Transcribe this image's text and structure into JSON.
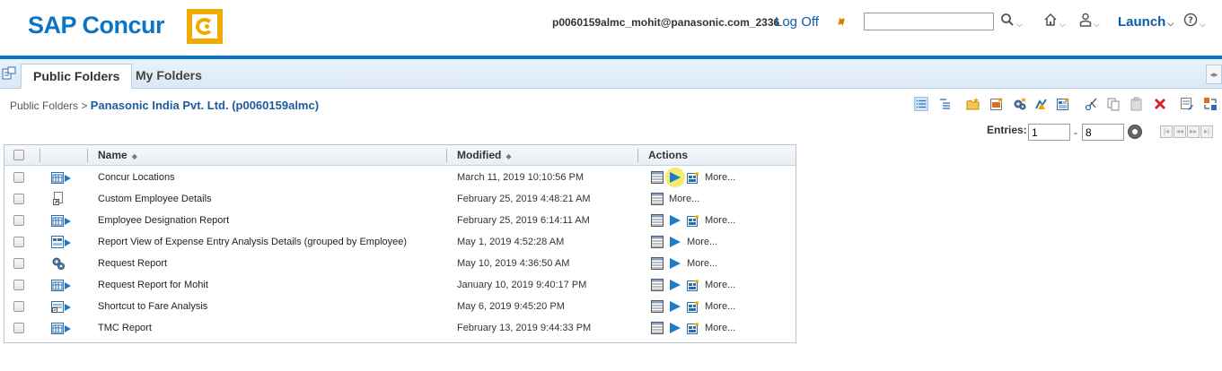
{
  "header": {
    "logo_text": "SAP Concur",
    "user_id": "p0060159almc_mohit@panasonic.com_2336",
    "logoff_label": "Log Off",
    "search_value": "",
    "launch_label": "Launch"
  },
  "tabs": [
    {
      "label": "Public Folders",
      "active": true
    },
    {
      "label": "My Folders",
      "active": false
    }
  ],
  "breadcrumb": {
    "root": "Public Folders",
    "separator": ">",
    "current": "Panasonic India Pvt. Ltd. (p0060159almc)"
  },
  "entries": {
    "label": "Entries:",
    "from": "1",
    "to": "8",
    "dash": "-"
  },
  "table": {
    "columns": [
      "Name",
      "Modified",
      "Actions"
    ],
    "more_label": "More...",
    "rows": [
      {
        "name": "Concur Locations",
        "modified": "March 11, 2019 10:10:56 PM",
        "icon": "report-run-icon",
        "actions": [
          "view",
          "run",
          "schedule"
        ]
      },
      {
        "name": "Custom Employee Details",
        "modified": "February 25, 2019 4:48:21 AM",
        "icon": "shortcut-doc-icon",
        "actions": [
          "view"
        ]
      },
      {
        "name": "Employee Designation Report",
        "modified": "February 25, 2019 6:14:11 AM",
        "icon": "report-run-icon",
        "actions": [
          "view",
          "run",
          "schedule"
        ]
      },
      {
        "name": "Report View of Expense Entry Analysis Details (grouped by Employee)",
        "modified": "May 1, 2019 4:52:28 AM",
        "icon": "report-view-icon",
        "actions": [
          "view",
          "run"
        ]
      },
      {
        "name": "Request Report",
        "modified": "May 10, 2019 4:36:50 AM",
        "icon": "gears-icon",
        "actions": [
          "view",
          "run"
        ]
      },
      {
        "name": "Request Report for Mohit",
        "modified": "January 10, 2019 9:40:17 PM",
        "icon": "report-run-icon",
        "actions": [
          "view",
          "run",
          "schedule"
        ]
      },
      {
        "name": "Shortcut to Fare Analysis",
        "modified": "May 6, 2019 9:45:20 PM",
        "icon": "report-shortcut-icon",
        "actions": [
          "view",
          "run",
          "schedule"
        ]
      },
      {
        "name": "TMC Report",
        "modified": "February 13, 2019 9:44:33 PM",
        "icon": "report-run-icon",
        "actions": [
          "view",
          "run",
          "schedule"
        ]
      }
    ]
  },
  "colors": {
    "brand_blue": "#0a74c5",
    "logo_yellow": "#f0ab00",
    "run_blue": "#1f7ac4"
  }
}
